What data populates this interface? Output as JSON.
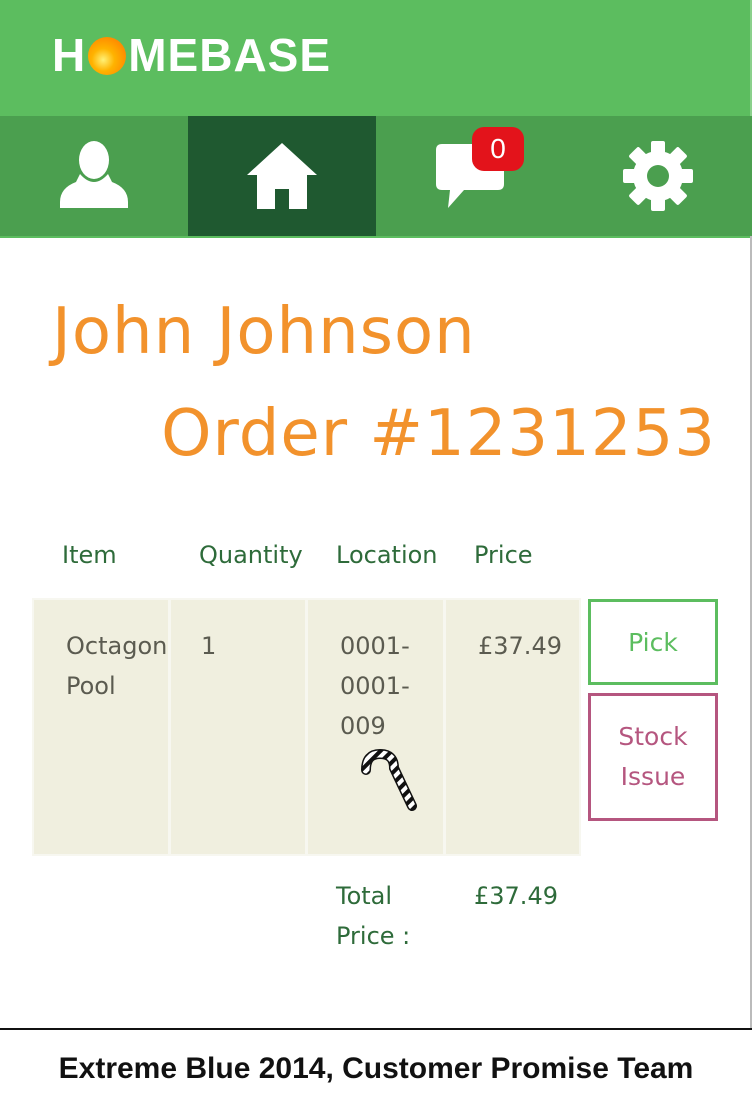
{
  "header": {
    "logo_left": "H",
    "logo_right": "MEBASE",
    "logo_sun_icon": "sun-logo-icon"
  },
  "nav": {
    "items": [
      {
        "name": "profile",
        "icon": "user-icon",
        "active": false
      },
      {
        "name": "home",
        "icon": "home-icon",
        "active": true
      },
      {
        "name": "messages",
        "icon": "chat-bubble-icon",
        "active": false
      },
      {
        "name": "settings",
        "icon": "gear-icon",
        "active": false
      }
    ],
    "message_count": "0"
  },
  "customer": {
    "name": "John Johnson",
    "order": "Order #1231253"
  },
  "table": {
    "headers": [
      "Item",
      "Quantity",
      "Location",
      "Price"
    ],
    "rows": [
      {
        "item_line1": "Octagon",
        "item_line2": "Pool",
        "quantity": "1",
        "location_line1": "0001-",
        "location_line2": "0001-",
        "location_line3": "009",
        "location_icon": "candy-cane-icon",
        "price": "£37.49"
      }
    ]
  },
  "actions": {
    "pick": "Pick",
    "stock_line1": "Stock",
    "stock_line2": "Issue"
  },
  "totals": {
    "label_line1": "Total",
    "label_line2": "Price :",
    "value": "£37.49"
  },
  "footer": {
    "text": "Extreme Blue 2014, Customer Promise Team"
  },
  "colors": {
    "brand_green": "#5cbd5f",
    "nav_green": "#4b9f4f",
    "nav_active": "#1f5930",
    "accent_orange": "#f2922c",
    "stock_issue": "#b5567f",
    "badge_red": "#e3131b"
  }
}
